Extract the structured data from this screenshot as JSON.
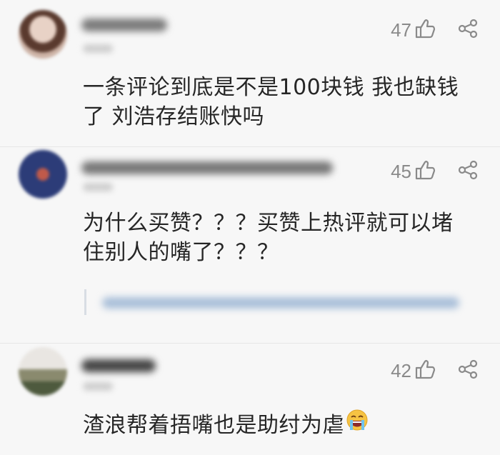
{
  "comments": [
    {
      "likes": "47",
      "text": "一条评论到底是不是100块钱 我也缺钱了 刘浩存结账快吗"
    },
    {
      "likes": "45",
      "text": "为什么买赞？？？买赞上热评就可以堵住别人的嘴了？？？"
    },
    {
      "likes": "42",
      "text": "渣浪帮着捂嘴也是助纣为虐"
    }
  ],
  "icons": {
    "like": "thumbs-up-icon",
    "share": "share-icon",
    "emoji": "tears-of-joy-emoji"
  },
  "colors": {
    "text": "#262626",
    "meta": "#8a8a8a",
    "reply_link": "#a9bfd9",
    "background": "#f7f7f7"
  }
}
